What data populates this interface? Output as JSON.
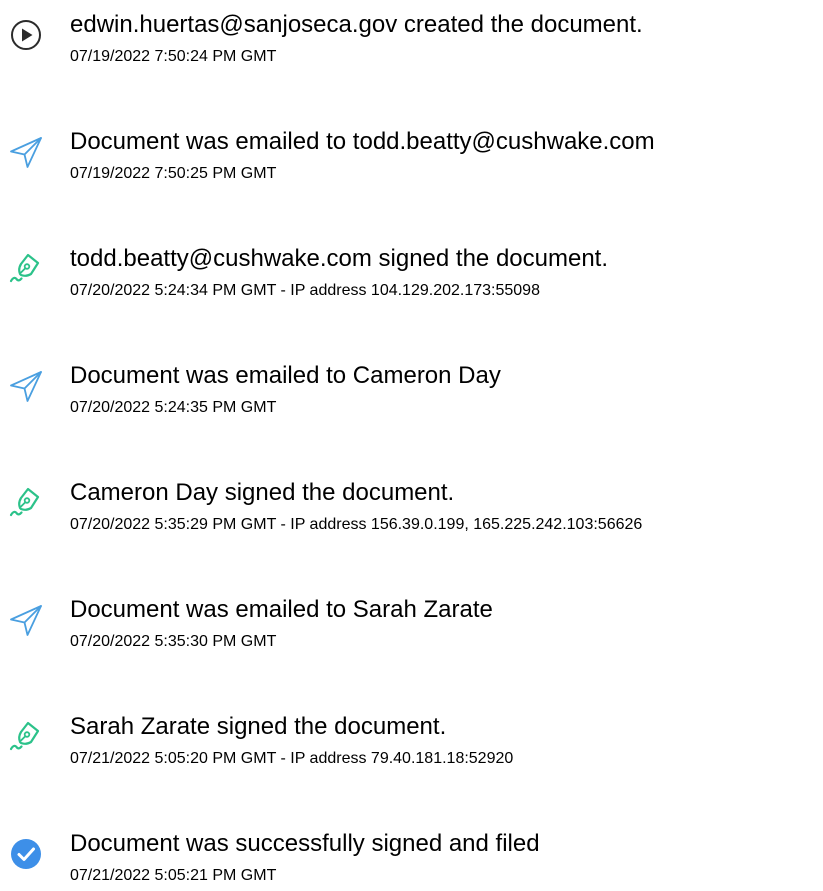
{
  "colors": {
    "send_icon": "#4a9fe0",
    "sign_icon": "#2cc28a",
    "complete_icon": "#3d8fe8",
    "text": "#000000"
  },
  "events": [
    {
      "icon": "play-circle-icon",
      "title": "edwin.huertas@sanjoseca.gov created the document.",
      "meta": "07/19/2022 7:50:24 PM GMT"
    },
    {
      "icon": "send-icon",
      "title": "Document was emailed to todd.beatty@cushwake.com",
      "meta": "07/19/2022 7:50:25 PM GMT"
    },
    {
      "icon": "pen-sign-icon",
      "title": "todd.beatty@cushwake.com signed the document.",
      "meta": "07/20/2022 5:24:34 PM GMT - IP address 104.129.202.173:55098"
    },
    {
      "icon": "send-icon",
      "title": "Document was emailed to Cameron Day",
      "meta": "07/20/2022 5:24:35 PM GMT"
    },
    {
      "icon": "pen-sign-icon",
      "title": "Cameron Day signed the document.",
      "meta": "07/20/2022 5:35:29 PM GMT - IP address 156.39.0.199, 165.225.242.103:56626"
    },
    {
      "icon": "send-icon",
      "title": "Document was emailed to Sarah Zarate",
      "meta": "07/20/2022 5:35:30 PM GMT"
    },
    {
      "icon": "pen-sign-icon",
      "title": "Sarah Zarate signed the document.",
      "meta": "07/21/2022 5:05:20 PM GMT - IP address 79.40.181.18:52920"
    },
    {
      "icon": "check-circle-icon",
      "title": "Document was successfully signed and filed",
      "meta": "07/21/2022 5:05:21 PM GMT"
    }
  ]
}
